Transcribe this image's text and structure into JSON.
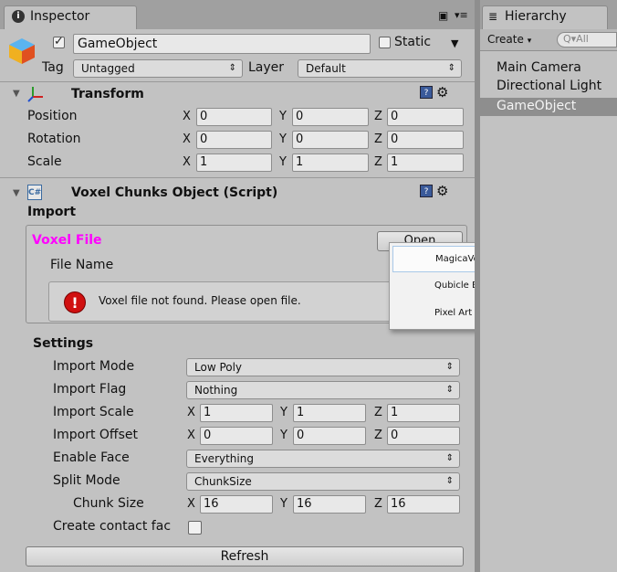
{
  "inspector": {
    "tab_label": "Inspector",
    "gameobject": {
      "enabled": true,
      "name": "GameObject",
      "static_label": "Static",
      "tag_label": "Tag",
      "tag_value": "Untagged",
      "layer_label": "Layer",
      "layer_value": "Default"
    },
    "transform": {
      "title": "Transform",
      "rows": [
        {
          "label": "Position",
          "x": "0",
          "y": "0",
          "z": "0"
        },
        {
          "label": "Rotation",
          "x": "0",
          "y": "0",
          "z": "0"
        },
        {
          "label": "Scale",
          "x": "1",
          "y": "1",
          "z": "1"
        }
      ]
    },
    "script": {
      "title": "Voxel Chunks Object (Script)",
      "import_label": "Import",
      "voxel_file_label": "Voxel File",
      "open_button": "Open",
      "file_name_label": "File Name",
      "error_message": "Voxel file not found. Please open file.",
      "settings_label": "Settings",
      "import_mode_label": "Import Mode",
      "import_mode_value": "Low Poly",
      "import_flag_label": "Import Flag",
      "import_flag_value": "Nothing",
      "import_scale": {
        "label": "Import Scale",
        "x": "1",
        "y": "1",
        "z": "1"
      },
      "import_offset": {
        "label": "Import Offset",
        "x": "0",
        "y": "0",
        "z": "0"
      },
      "enable_face_label": "Enable Face",
      "enable_face_value": "Everything",
      "split_mode_label": "Split Mode",
      "split_mode_value": "ChunkSize",
      "chunk_size": {
        "label": "Chunk Size",
        "x": "16",
        "y": "16",
        "z": "16"
      },
      "create_contact_label": "Create contact fac",
      "refresh_button": "Refresh"
    },
    "axis": {
      "x": "X",
      "y": "Y",
      "z": "Z"
    },
    "dropdown_menu": {
      "items": [
        "MagicaVoxel (*.vox)",
        "Qubicle Binary (*.qb)",
        "Pixel Art (*.png)"
      ]
    }
  },
  "hierarchy": {
    "tab_label": "Hierarchy",
    "create_label": "Create",
    "search_placeholder": "Q▾All",
    "items": [
      "Main Camera",
      "Directional Light",
      "GameObject"
    ],
    "selected_index": 2
  },
  "colors": {
    "panel": "#c2c2c2",
    "selected_item": "#8e8e8e",
    "voxel_file_label": "#ff00ff",
    "error_icon": "#d01010"
  }
}
